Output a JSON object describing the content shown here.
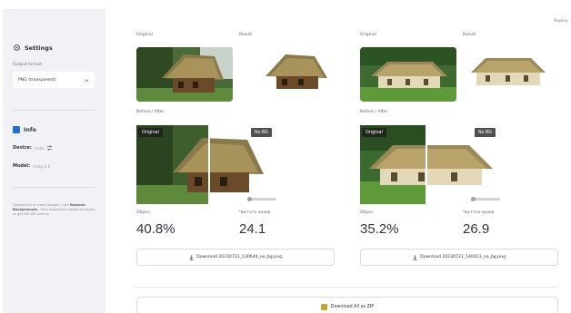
{
  "app": {
    "deploy_label": "Deploy"
  },
  "sidebar": {
    "settings_title": "Settings",
    "output_format_label": "Output format",
    "output_format_value": "PNG (transparent)",
    "info_title": "Info",
    "device_label": "Device:",
    "device_value": "cuda",
    "model_label": "Model:",
    "model_value": "rmbg-2.0",
    "note_prefix": "Upload one or more images, click",
    "note_bold": "Remove Backgrounds",
    "note_suffix": ", then download individual results or get the ZIP archive."
  },
  "results": [
    {
      "original_label": "Original",
      "result_label": "Result",
      "before_after_label": "Before / After",
      "tag_original": "Original",
      "tag_nobg": "No BG",
      "metric1_label": "Обрез",
      "metric1_value": "40.8%",
      "metric2_label": "Чистота краев",
      "metric2_value": "24.1",
      "download_label": "Download 20230731_130644_no_bg.png"
    },
    {
      "original_label": "Original",
      "result_label": "Result",
      "before_after_label": "Before / After",
      "tag_original": "Original",
      "tag_nobg": "No BG",
      "metric1_label": "Обрез",
      "metric1_value": "35.2%",
      "metric2_label": "Чистота краев",
      "metric2_value": "26.9",
      "download_label": "Download 20230731_140423_no_bg.png"
    }
  ],
  "zip_button_label": "Download All as ZIP",
  "colors": {
    "sidebar_bg": "#f0f2f6",
    "accent_info": "#1f6fd6",
    "zip_icon": "#c9a233"
  },
  "icons": [
    "gear-icon",
    "chevron-down-icon",
    "info-icon",
    "swap-icon",
    "download-icon",
    "zip-icon"
  ]
}
